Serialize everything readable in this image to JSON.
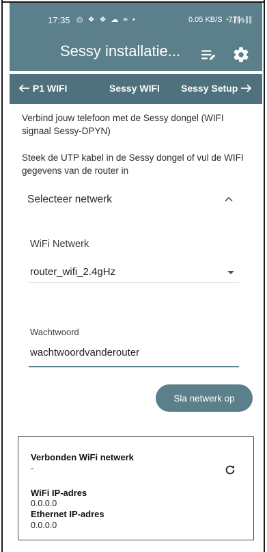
{
  "status_bar": {
    "time": "17:35",
    "notification_icons": "◎ ❖ ❖ ☁ ≡ •",
    "network_info": "0.05 KB/S ◔ .∥∥ .∥∥",
    "battery": "77%"
  },
  "app_bar": {
    "title": "Sessy installatie...",
    "actions": [
      "sort-edit-icon",
      "settings-gear-icon"
    ]
  },
  "tabs": {
    "back": "P1 WIFI",
    "current": "Sessy WIFI",
    "next": "Sessy Setup"
  },
  "intro": {
    "line1": "Verbind jouw telefoon met de Sessy dongel (WIFI signaal Sessy-DPYN)",
    "line2": "Steek de UTP kabel in de Sessy dongel of vul de WIFI gegevens van de router in"
  },
  "network_section": {
    "title": "Selecteer netwerk",
    "wifi_label": "WiFi Netwerk",
    "wifi_value": "router_wifi_2.4gHz",
    "password_label": "Wachtwoord",
    "password_value": "wachtwoordvanderouter",
    "save_label": "Sla netwerk op"
  },
  "connection_status": {
    "connected_label": "Verbonden WiFi netwerk",
    "connected_value": "-",
    "wifi_ip_label": "WiFi IP-adres",
    "wifi_ip_value": "0.0.0.0",
    "ethernet_ip_label": "Ethernet IP-adres",
    "ethernet_ip_value": "0.0.0.0"
  },
  "colors": {
    "primary": "#5b7f8b",
    "tab_bar": "#4f717d"
  }
}
